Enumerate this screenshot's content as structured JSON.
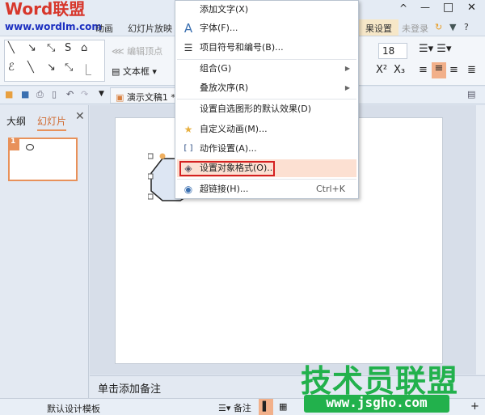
{
  "watermark_top": {
    "logo": "Word联盟",
    "url": "www.wordlm.com"
  },
  "watermark_bottom": {
    "logo": "技术员联盟",
    "url": "www.jsgho.com"
  },
  "window_controls": {
    "collapse": "^",
    "minimize": "—",
    "maximize": "□",
    "close": "✕"
  },
  "ribbon_tabs": [
    "动画",
    "幻灯片放映",
    "果设置"
  ],
  "account": {
    "login": "未登录",
    "help": "?"
  },
  "ribbon": {
    "edit_points": "编辑顶点",
    "textbox": "文本框",
    "font_size": "18"
  },
  "document_tab": "演示文稿1 *",
  "left_panel": {
    "tabs": [
      "大纲",
      "幻灯片"
    ],
    "slide_number": "1"
  },
  "notes_placeholder": "单击添加备注",
  "status_bar": {
    "template": "默认设计模板",
    "notes": "备注"
  },
  "context_menu": {
    "items": [
      {
        "label": "添加文字(X)",
        "icon": ""
      },
      {
        "label": "字体(F)...",
        "icon": "font-icon"
      },
      {
        "label": "项目符号和编号(B)...",
        "icon": "bullets-icon"
      },
      {
        "label": "组合(G)",
        "submenu": true
      },
      {
        "label": "叠放次序(R)",
        "submenu": true
      },
      {
        "label": "设置自选图形的默认效果(D)"
      },
      {
        "label": "自定义动画(M)...",
        "icon": "custom-animation-icon"
      },
      {
        "label": "动作设置(A)...",
        "icon": "action-settings-icon"
      },
      {
        "label": "设置对象格式(O)...",
        "icon": "format-object-icon",
        "highlighted": true
      },
      {
        "label": "超链接(H)...",
        "icon": "hyperlink-icon",
        "shortcut": "Ctrl+K"
      }
    ]
  },
  "colors": {
    "highlight": "#fce0d2",
    "red_box": "#d42020",
    "accent_orange": "#e8915a",
    "watermark_green": "#22b14c"
  }
}
